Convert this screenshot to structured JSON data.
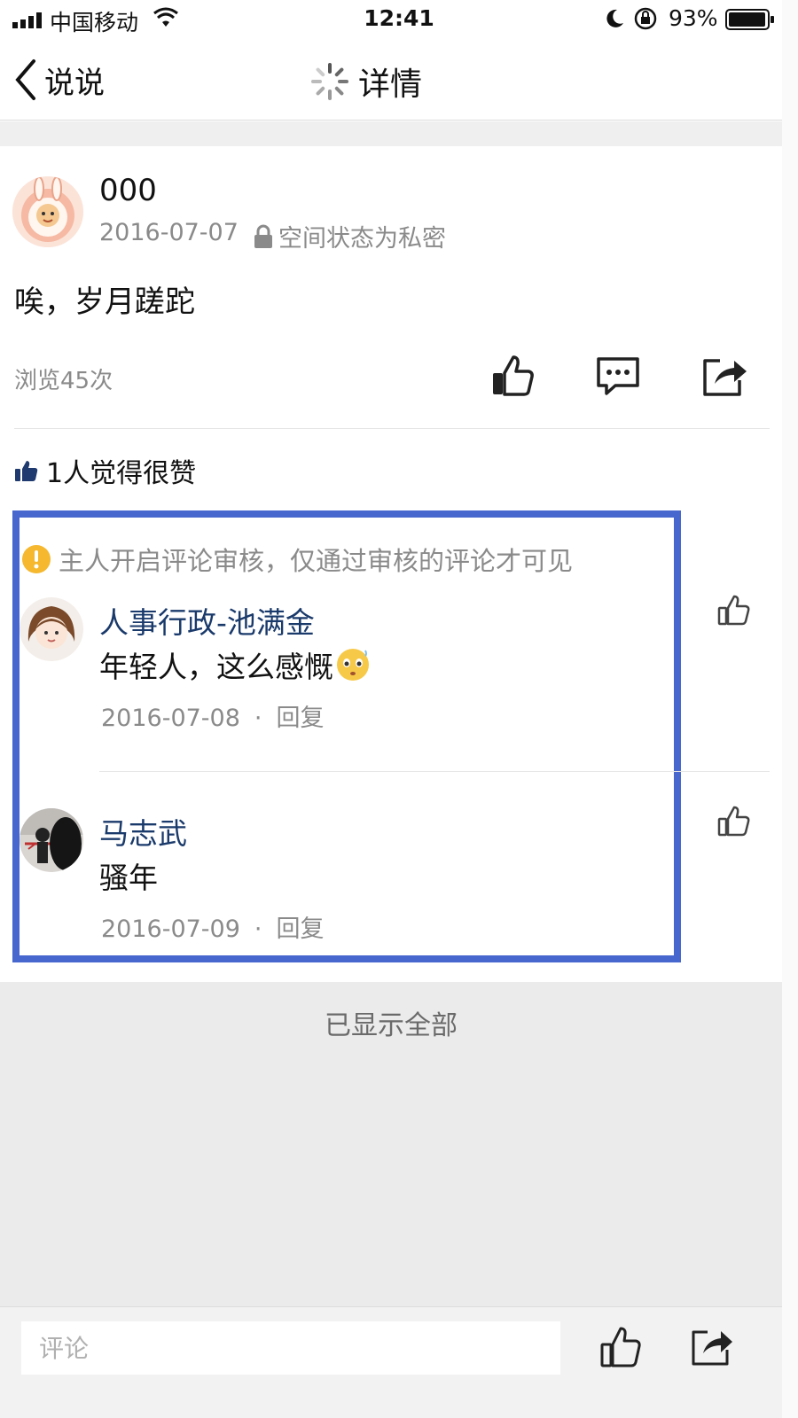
{
  "status_bar": {
    "carrier": "中国移动",
    "time": "12:41",
    "battery": "93%"
  },
  "nav": {
    "back_label": "说说",
    "title": "详情"
  },
  "post": {
    "author": "000",
    "date": "2016-07-07",
    "privacy": "空间状态为私密",
    "content": "唉，岁月蹉跎",
    "views": "浏览45次",
    "likes": "1人觉得很赞"
  },
  "notice": "主人开启评论审核，仅通过审核的评论才可见",
  "comments": [
    {
      "name": "人事行政-池满金",
      "text": "年轻人，这么感慨",
      "date": "2016-07-08",
      "dot": "·",
      "reply": "回复"
    },
    {
      "name": "马志武",
      "text": "骚年",
      "date": "2016-07-09",
      "dot": "·",
      "reply": "回复"
    }
  ],
  "footer": {
    "all_shown": "已显示全部"
  },
  "input": {
    "placeholder": "评论"
  },
  "colors": {
    "highlight_border": "#4767cf",
    "comment_name": "#1a3a6b",
    "warning": "#f5b82e"
  }
}
